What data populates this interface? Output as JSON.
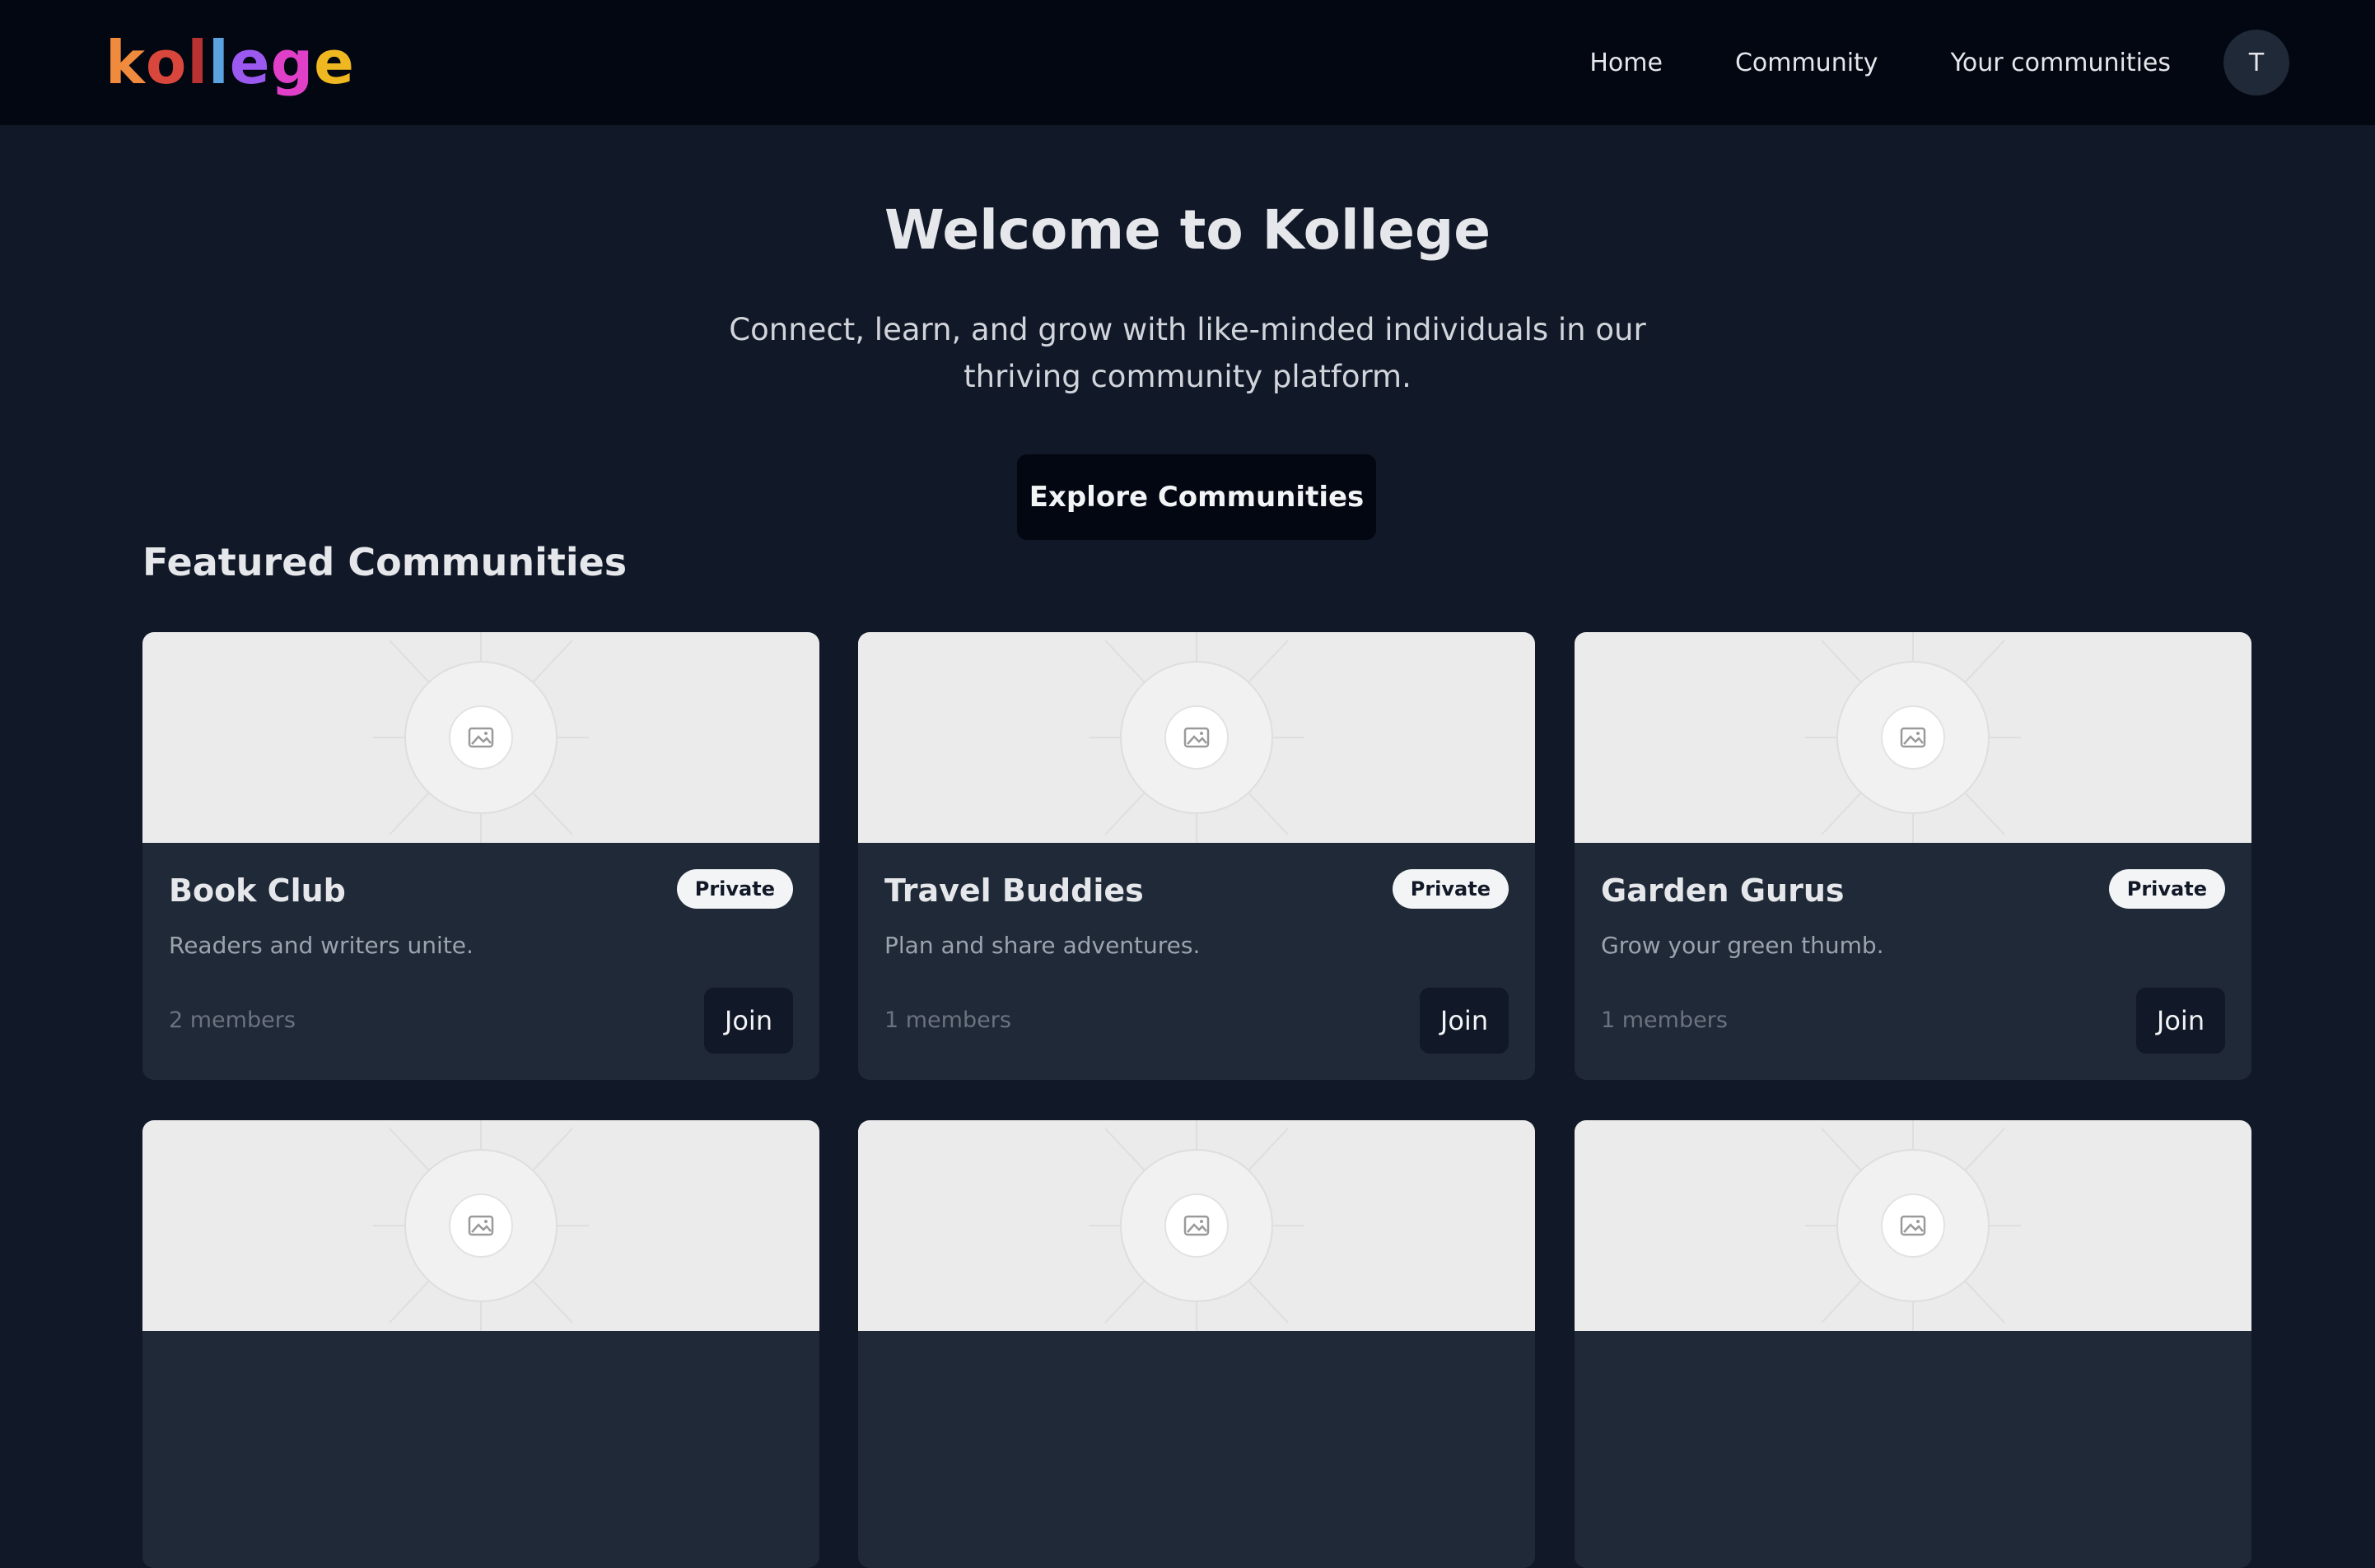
{
  "navbar": {
    "logo_letters": [
      {
        "char": "k",
        "color": "#f08a3c"
      },
      {
        "char": "o",
        "color": "#d9463b"
      },
      {
        "char": "l",
        "color": "#b83232"
      },
      {
        "char": "l",
        "color": "#5aa3e0"
      },
      {
        "char": "e",
        "color": "#9b59f0"
      },
      {
        "char": "g",
        "color": "#e040c8"
      },
      {
        "char": "e",
        "color": "#f0b820"
      }
    ],
    "links": [
      "Home",
      "Community",
      "Your communities"
    ],
    "avatar_initial": "T"
  },
  "hero": {
    "title": "Welcome to Kollege",
    "subtitle": "Connect, learn, and grow with like-minded individuals in our thriving community platform.",
    "cta_label": "Explore Communities"
  },
  "featured": {
    "title": "Featured Communities",
    "cards": [
      {
        "title": "Book Club",
        "badge": "Private",
        "description": "Readers and writers unite.",
        "members": "2 members",
        "join_label": "Join"
      },
      {
        "title": "Travel Buddies",
        "badge": "Private",
        "description": "Plan and share adventures.",
        "members": "1 members",
        "join_label": "Join"
      },
      {
        "title": "Garden Gurus",
        "badge": "Private",
        "description": "Grow your green thumb.",
        "members": "1 members",
        "join_label": "Join"
      },
      {
        "title": "",
        "badge": "",
        "description": "",
        "members": "",
        "join_label": ""
      },
      {
        "title": "",
        "badge": "",
        "description": "",
        "members": "",
        "join_label": ""
      },
      {
        "title": "",
        "badge": "",
        "description": "",
        "members": "",
        "join_label": ""
      }
    ]
  },
  "colors": {
    "background": "#111827",
    "navbar": "#030712",
    "card": "#1f2937",
    "placeholder": "#ebebeb"
  },
  "icons": {
    "placeholder": "image-placeholder-icon"
  }
}
